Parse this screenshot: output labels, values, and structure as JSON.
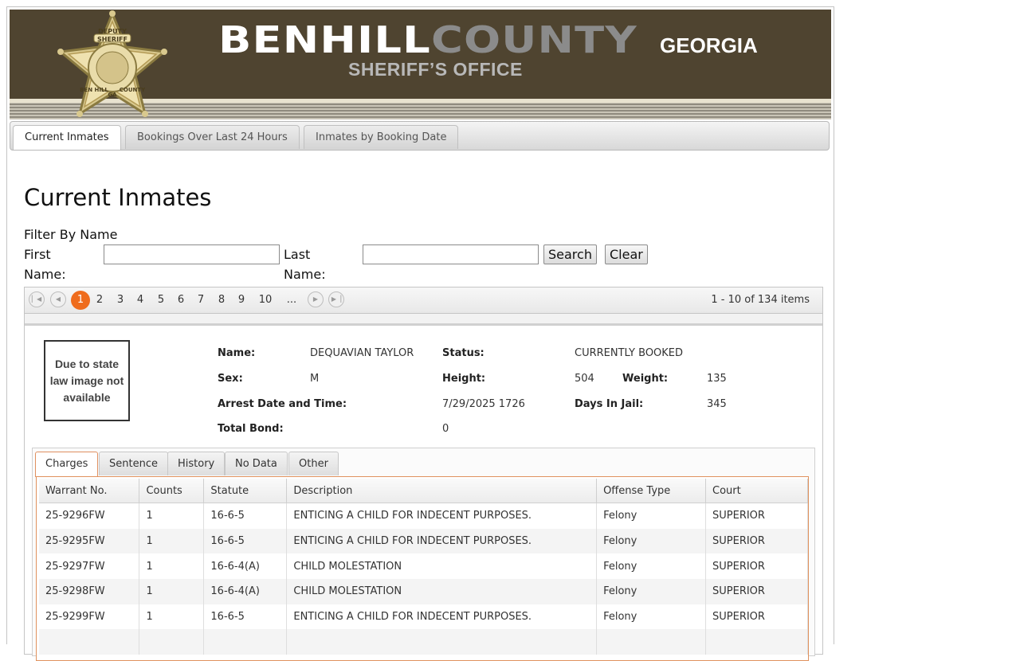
{
  "header": {
    "brand_part1": "BENHILL",
    "brand_part2": "COUNTY",
    "state": "GEORGIA",
    "office": "SHERIFF’S OFFICE",
    "badge_text": [
      "DEPUTY",
      "SHERIFF",
      "BEN HILL",
      "GA",
      "COUNTY"
    ]
  },
  "tabs": [
    {
      "label": "Current Inmates"
    },
    {
      "label": "Bookings Over Last 24 Hours"
    },
    {
      "label": "Inmates by Booking Date"
    }
  ],
  "page_title": "Current Inmates",
  "filter": {
    "heading": "Filter By Name",
    "first_name_label": "First Name:",
    "first_name_value": "",
    "last_name_label": "Last Name:",
    "last_name_value": "",
    "search_label": "Search",
    "clear_label": "Clear"
  },
  "pager": {
    "pages": [
      "1",
      "2",
      "3",
      "4",
      "5",
      "6",
      "7",
      "8",
      "9",
      "10",
      "..."
    ],
    "current_page": "1",
    "info": "1 - 10 of 134 items"
  },
  "inmate": {
    "image_text": "Due to state law image not available",
    "name_label": "Name:",
    "name": "DEQUAVIAN TAYLOR",
    "status_label": "Status:",
    "status": "CURRENTLY BOOKED",
    "sex_label": "Sex:",
    "sex": "M",
    "height_label": "Height:",
    "height": "504",
    "weight_label": "Weight:",
    "weight": "135",
    "arrest_label": "Arrest Date and Time:",
    "arrest": "7/29/2025 1726",
    "days_label": "Days In Jail:",
    "days": "345",
    "bond_label": "Total Bond:",
    "bond": "0"
  },
  "inner_tabs": [
    {
      "label": "Charges"
    },
    {
      "label": "Sentence"
    },
    {
      "label": "History"
    },
    {
      "label": "No Data"
    },
    {
      "label": "Other"
    }
  ],
  "charges": {
    "columns": [
      "Warrant No.",
      "Counts",
      "Statute",
      "Description",
      "Offense Type",
      "Court"
    ],
    "rows": [
      [
        "25-9296FW",
        "1",
        "16-6-5",
        "ENTICING A CHILD FOR INDECENT PURPOSES.",
        "Felony",
        "SUPERIOR"
      ],
      [
        "25-9295FW",
        "1",
        "16-6-5",
        "ENTICING A CHILD FOR INDECENT PURPOSES.",
        "Felony",
        "SUPERIOR"
      ],
      [
        "25-9297FW",
        "1",
        "16-6-4(A)",
        "CHILD MOLESTATION",
        "Felony",
        "SUPERIOR"
      ],
      [
        "25-9298FW",
        "1",
        "16-6-4(A)",
        "CHILD MOLESTATION",
        "Felony",
        "SUPERIOR"
      ],
      [
        "25-9299FW",
        "1",
        "16-6-5",
        "ENTICING A CHILD FOR INDECENT PURPOSES.",
        "Felony",
        "SUPERIOR"
      ],
      [
        "",
        "",
        "",
        "",
        "",
        ""
      ]
    ]
  }
}
